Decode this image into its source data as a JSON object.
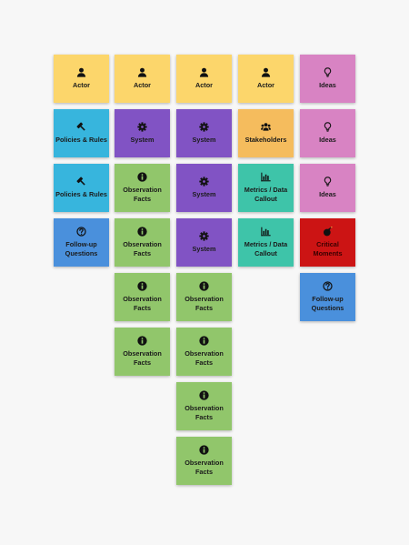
{
  "colors": {
    "yellow": "#fcd66b",
    "pink": "#d883c3",
    "cyan": "#37b5dd",
    "purple": "#8153c4",
    "green": "#91c66b",
    "orange": "#f5bc5d",
    "teal": "#3ec4a9",
    "red": "#cc1414",
    "blue": "#4a90dc"
  },
  "columns": [
    {
      "notes": [
        {
          "label": "Actor",
          "icon": "user-icon",
          "color": "yellow"
        },
        {
          "label": "Policies & Rules",
          "icon": "gavel-icon",
          "color": "cyan"
        },
        {
          "label": "Policies & Rules",
          "icon": "gavel-icon",
          "color": "cyan"
        },
        {
          "label": "Follow-up Questions",
          "icon": "question-circle-icon",
          "color": "blue"
        }
      ]
    },
    {
      "notes": [
        {
          "label": "Actor",
          "icon": "user-icon",
          "color": "yellow"
        },
        {
          "label": "System",
          "icon": "gear-icon",
          "color": "purple"
        },
        {
          "label": "Observation Facts",
          "icon": "info-circle-icon",
          "color": "green"
        },
        {
          "label": "Observation Facts",
          "icon": "info-circle-icon",
          "color": "green"
        },
        {
          "label": "Observation Facts",
          "icon": "info-circle-icon",
          "color": "green"
        },
        {
          "label": "Observation Facts",
          "icon": "info-circle-icon",
          "color": "green"
        }
      ]
    },
    {
      "notes": [
        {
          "label": "Actor",
          "icon": "user-icon",
          "color": "yellow"
        },
        {
          "label": "System",
          "icon": "gear-icon",
          "color": "purple"
        },
        {
          "label": "System",
          "icon": "gear-icon",
          "color": "purple"
        },
        {
          "label": "System",
          "icon": "gear-icon",
          "color": "purple"
        },
        {
          "label": "Observation Facts",
          "icon": "info-circle-icon",
          "color": "green"
        },
        {
          "label": "Observation Facts",
          "icon": "info-circle-icon",
          "color": "green"
        },
        {
          "label": "Observation Facts",
          "icon": "info-circle-icon",
          "color": "green"
        },
        {
          "label": "Observation Facts",
          "icon": "info-circle-icon",
          "color": "green"
        }
      ]
    },
    {
      "notes": [
        {
          "label": "Actor",
          "icon": "user-icon",
          "color": "yellow"
        },
        {
          "label": "Stakeholders",
          "icon": "users-icon",
          "color": "orange"
        },
        {
          "label": "Metrics / Data Callout",
          "icon": "bar-chart-icon",
          "color": "teal"
        },
        {
          "label": "Metrics / Data Callout",
          "icon": "bar-chart-icon",
          "color": "teal"
        }
      ]
    },
    {
      "notes": [
        {
          "label": "Ideas",
          "icon": "lightbulb-icon",
          "color": "pink"
        },
        {
          "label": "Ideas",
          "icon": "lightbulb-icon",
          "color": "pink"
        },
        {
          "label": "Ideas",
          "icon": "lightbulb-icon",
          "color": "pink"
        },
        {
          "label": "Critical Moments",
          "icon": "bomb-icon",
          "color": "red"
        },
        {
          "label": "Follow-up Questions",
          "icon": "question-circle-icon",
          "color": "blue"
        }
      ]
    }
  ]
}
